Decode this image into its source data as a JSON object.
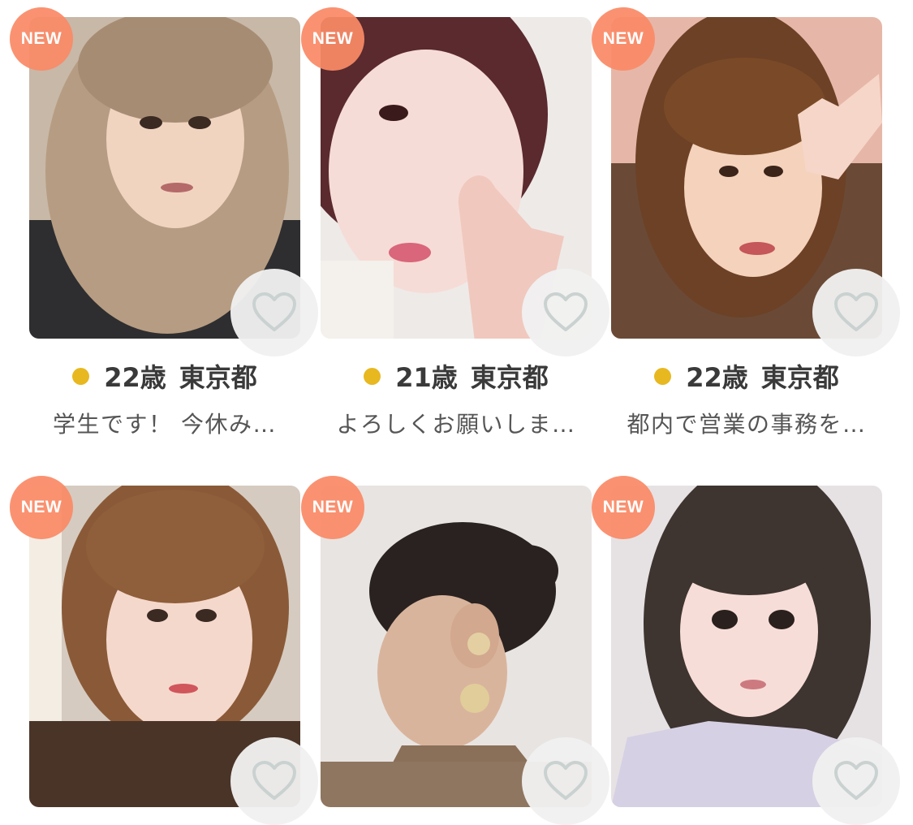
{
  "colors": {
    "new_badge": "#FA8A66",
    "online_dot": "#E8B820",
    "like_button_bg": "#F0F0F0",
    "heart_stroke": "#C9D2D0"
  },
  "badge_label": "NEW",
  "like_icon": "heart-outline-icon",
  "profiles": [
    {
      "age": "22歳",
      "prefecture": "東京都",
      "message": "学生です！ 今休み…"
    },
    {
      "age": "21歳",
      "prefecture": "東京都",
      "message": "よろしくお願いしま…"
    },
    {
      "age": "22歳",
      "prefecture": "東京都",
      "message": "都内で営業の事務を…"
    },
    {
      "age": "",
      "prefecture": "",
      "message": ""
    },
    {
      "age": "",
      "prefecture": "",
      "message": ""
    },
    {
      "age": "",
      "prefecture": "",
      "message": ""
    }
  ]
}
